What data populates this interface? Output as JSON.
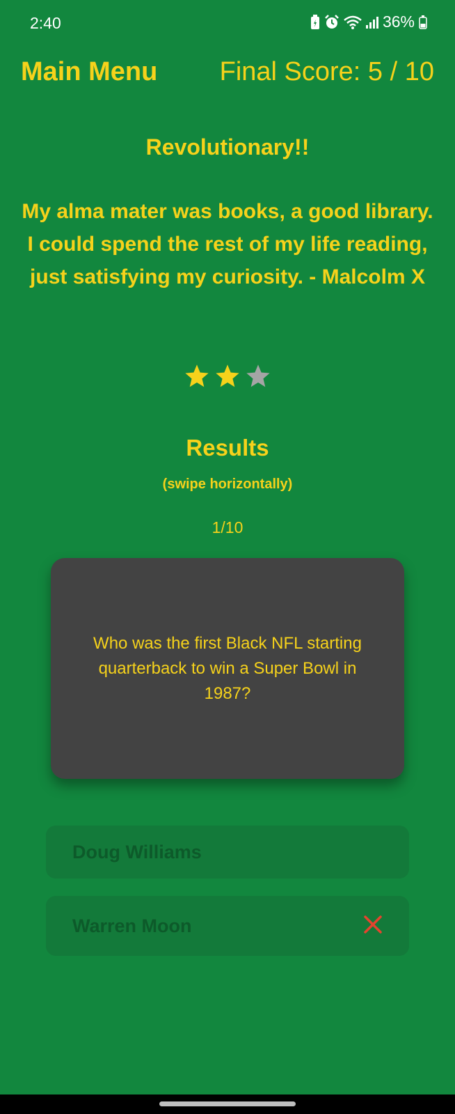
{
  "status_bar": {
    "time": "2:40",
    "battery": "36%",
    "icons": [
      "battery-saver-icon",
      "alarm-icon",
      "wifi-icon",
      "signal-icon",
      "battery-icon"
    ]
  },
  "header": {
    "menu_label": "Main Menu",
    "score_label": "Final Score: 5 / 10"
  },
  "result": {
    "verdict": "Revolutionary!!",
    "quote": "My alma mater was books, a good library. I could spend the rest of my life reading, just satisfying my curiosity. - Malcolm X",
    "rating": {
      "filled": 2,
      "total": 3
    }
  },
  "results_section": {
    "title": "Results",
    "hint": "(swipe horizontally)",
    "page": "1/10"
  },
  "question_card": {
    "question": "Who was the first Black NFL starting quarterback to win a Super Bowl in 1987?"
  },
  "answers": [
    {
      "label": "Doug Williams",
      "marker": ""
    },
    {
      "label": "Warren Moon",
      "marker": "close-icon"
    }
  ],
  "colors": {
    "background": "#12873e",
    "accent": "#f6d21b",
    "card": "#434343",
    "answer_bg": "#137a3a",
    "answer_text": "#0d5a2a",
    "wrong_mark": "#e5432e",
    "star_empty": "#a5a5a5"
  }
}
